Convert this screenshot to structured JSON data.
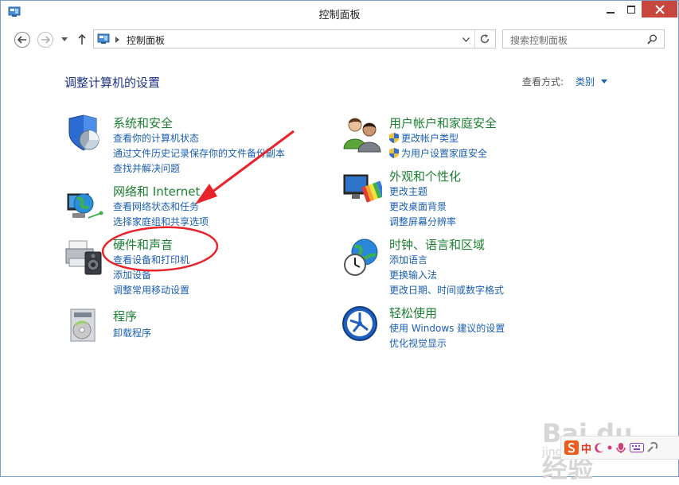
{
  "window": {
    "title": "控制面板"
  },
  "nav": {
    "address": "控制面板",
    "search_placeholder": "搜索控制面板"
  },
  "main": {
    "heading": "调整计算机的设置",
    "view_by_label": "查看方式:",
    "view_by_value": "类别"
  },
  "categories_left": [
    {
      "title": "系统和安全",
      "links": [
        "查看你的计算机状态",
        "通过文件历史记录保存你的文件备份副本",
        "查找并解决问题"
      ]
    },
    {
      "title": "网络和 Internet",
      "links": [
        "查看网络状态和任务",
        "选择家庭组和共享选项"
      ]
    },
    {
      "title": "硬件和声音",
      "links": [
        "查看设备和打印机",
        "添加设备",
        "调整常用移动设置"
      ]
    },
    {
      "title": "程序",
      "links": [
        "卸载程序"
      ]
    }
  ],
  "categories_right": [
    {
      "title": "用户帐户和家庭安全",
      "links": [
        "更改帐户类型",
        "为用户设置家庭安全"
      ]
    },
    {
      "title": "外观和个性化",
      "links": [
        "更改主题",
        "更改桌面背景",
        "调整屏幕分辨率"
      ]
    },
    {
      "title": "时钟、语言和区域",
      "links": [
        "添加语言",
        "更换输入法",
        "更改日期、时间或数字格式"
      ]
    },
    {
      "title": "轻松使用",
      "links": [
        "使用 Windows 建议的设置",
        "优化视觉显示"
      ]
    }
  ],
  "watermark": {
    "brand": "Bai du 经验",
    "sub": "jingyan.baidu.com"
  },
  "ime": {
    "mode": "中"
  },
  "colors": {
    "title_green": "#1b7f32",
    "link_blue": "#1a5fb4",
    "annotation_red": "#e8232a",
    "close_red": "#c7463e"
  }
}
